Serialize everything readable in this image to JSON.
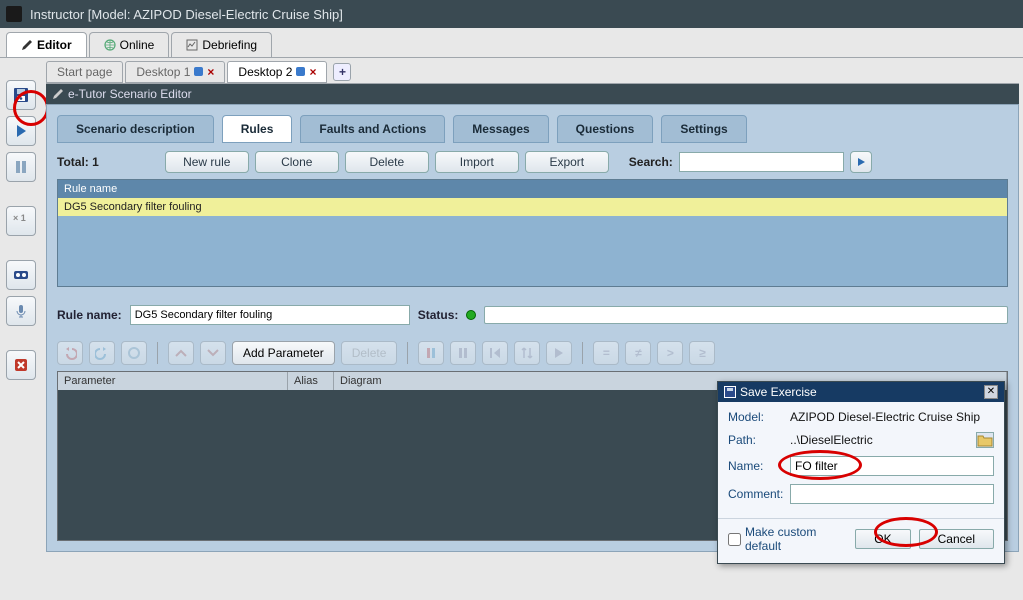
{
  "window": {
    "title": "Instructor [Model: AZIPOD Diesel-Electric Cruise Ship]"
  },
  "main_tabs": {
    "editor": "Editor",
    "online": "Online",
    "debriefing": "Debriefing"
  },
  "desk_tabs": {
    "start": "Start page",
    "d1": "Desktop 1",
    "d2": "Desktop 2"
  },
  "scn_header": "e-Tutor Scenario Editor",
  "scn_tabs": {
    "desc": "Scenario description",
    "rules": "Rules",
    "faults": "Faults and Actions",
    "msgs": "Messages",
    "q": "Questions",
    "set": "Settings"
  },
  "rules_toolbar": {
    "total_label": "Total: 1",
    "new": "New rule",
    "clone": "Clone",
    "delete": "Delete",
    "import": "Import",
    "export": "Export",
    "search_label": "Search:",
    "search_value": ""
  },
  "rules_table": {
    "col_name": "Rule name",
    "row0": "DG5 Secondary filter fouling"
  },
  "rule_detail": {
    "name_label": "Rule name:",
    "name_value": "DG5 Secondary filter fouling",
    "status_label": "Status:"
  },
  "param_toolbar": {
    "add": "Add Parameter",
    "delete": "Delete"
  },
  "param_grid": {
    "col_param": "Parameter",
    "col_alias": "Alias",
    "col_diag": "Diagram"
  },
  "save_dialog": {
    "title": "Save Exercise",
    "model_label": "Model:",
    "model_value": "AZIPOD Diesel-Electric Cruise Ship",
    "path_label": "Path:",
    "path_value": "..\\DieselElectric",
    "name_label": "Name:",
    "name_value": "FO filter",
    "comment_label": "Comment:",
    "comment_value": "",
    "make_default": "Make custom default",
    "ok": "OK",
    "cancel": "Cancel"
  },
  "left_toolbar": {
    "save": "save-icon",
    "play": "play-icon",
    "pause": "pause-icon",
    "x1": "x1-icon",
    "tape": "tape-icon",
    "mic": "mic-icon",
    "stop": "stop-icon"
  }
}
